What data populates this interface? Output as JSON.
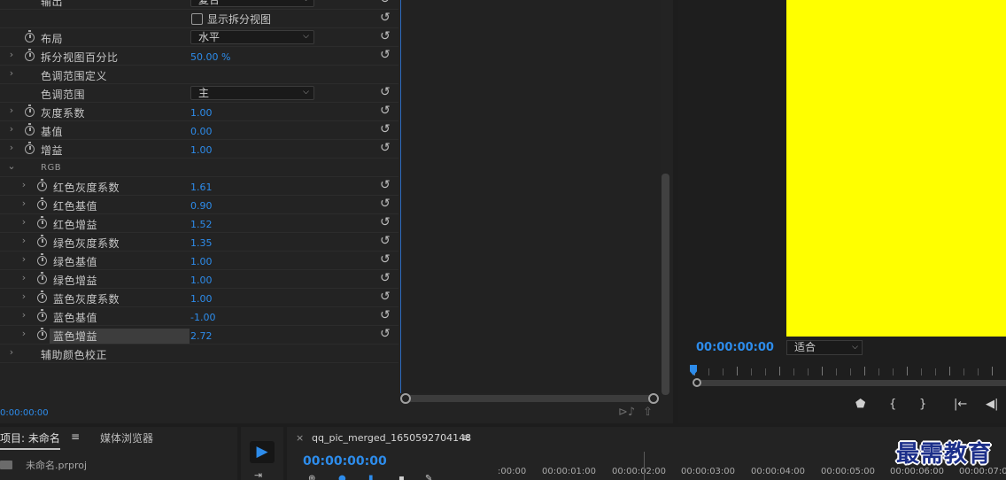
{
  "effect_controls": {
    "rows": [
      {
        "label": "输出",
        "kind": "dropdown",
        "value": "复合",
        "indent": 1,
        "chevron": false,
        "watch": false
      },
      {
        "label": "",
        "kind": "checkbox",
        "value": "显示拆分视图",
        "indent": 1,
        "chevron": false,
        "watch": false
      },
      {
        "label": "布局",
        "kind": "dropdown",
        "value": "水平",
        "indent": 1,
        "chevron": false,
        "watch": true
      },
      {
        "label": "拆分视图百分比",
        "kind": "number",
        "value": "50.00 %",
        "indent": 1,
        "chevron": true,
        "watch": true
      },
      {
        "label": "色调范围定义",
        "kind": "group",
        "value": "",
        "indent": 1,
        "chevron": true,
        "watch": false,
        "noreset": true
      },
      {
        "label": "色调范围",
        "kind": "dropdown",
        "value": "主",
        "indent": 1,
        "chevron": false,
        "watch": false
      },
      {
        "label": "灰度系数",
        "kind": "number",
        "value": "1.00",
        "indent": 1,
        "chevron": true,
        "watch": true
      },
      {
        "label": "基值",
        "kind": "number",
        "value": "0.00",
        "indent": 1,
        "chevron": true,
        "watch": true
      },
      {
        "label": "增益",
        "kind": "number",
        "value": "1.00",
        "indent": 1,
        "chevron": true,
        "watch": true
      },
      {
        "label": "RGB",
        "kind": "section",
        "value": "",
        "indent": 1,
        "chevron": "open",
        "watch": false,
        "noreset": true
      },
      {
        "label": "红色灰度系数",
        "kind": "number",
        "value": "1.61",
        "indent": 2,
        "chevron": true,
        "watch": true
      },
      {
        "label": "红色基值",
        "kind": "number",
        "value": "0.90",
        "indent": 2,
        "chevron": true,
        "watch": true
      },
      {
        "label": "红色增益",
        "kind": "number",
        "value": "1.52",
        "indent": 2,
        "chevron": true,
        "watch": true
      },
      {
        "label": "绿色灰度系数",
        "kind": "number",
        "value": "1.35",
        "indent": 2,
        "chevron": true,
        "watch": true
      },
      {
        "label": "绿色基值",
        "kind": "number",
        "value": "1.00",
        "indent": 2,
        "chevron": true,
        "watch": true
      },
      {
        "label": "绿色增益",
        "kind": "number",
        "value": "1.00",
        "indent": 2,
        "chevron": true,
        "watch": true
      },
      {
        "label": "蓝色灰度系数",
        "kind": "number",
        "value": "1.00",
        "indent": 2,
        "chevron": true,
        "watch": true
      },
      {
        "label": "蓝色基值",
        "kind": "number",
        "value": "-1.00",
        "indent": 2,
        "chevron": true,
        "watch": true
      },
      {
        "label": "蓝色增益",
        "kind": "number",
        "value": "2.72",
        "indent": 2,
        "chevron": true,
        "watch": true,
        "highlight": true
      },
      {
        "label": "辅助颜色校正",
        "kind": "group",
        "value": "",
        "indent": 1,
        "chevron": true,
        "watch": false,
        "noreset": true
      }
    ],
    "current_time": "0:00:00:00"
  },
  "program_monitor": {
    "timecode": "00:00:00:00",
    "fit": "适合",
    "video_color": "#ffff00"
  },
  "project_panel": {
    "tab_label": "项目: 未命名",
    "menu_icon": "≡",
    "media_browser_tab": "媒体浏览器",
    "file_name": "未命名.prproj"
  },
  "sequence": {
    "close": "×",
    "tab_label": "qq_pic_merged_1650592704148",
    "menu_icon": "≡",
    "timecode": "00:00:00:00",
    "ruler": [
      ":00:00",
      "00:00:01:00",
      "00:00:02:00",
      "00:00:03:00",
      "00:00:04:00",
      "00:00:05:00",
      "00:00:06:00",
      "00:00:07:0"
    ]
  },
  "watermark": "最需教育",
  "colors": {
    "accent": "#2d8ceb",
    "panel": "#232323",
    "background": "#1d1d1d"
  }
}
